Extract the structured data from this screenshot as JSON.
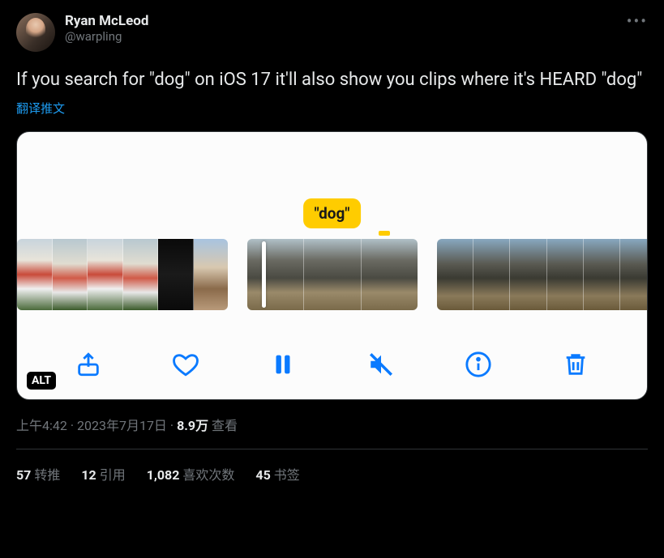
{
  "author": {
    "display_name": "Ryan McLeod",
    "handle": "@warpling"
  },
  "tweet_text": "If you search for \"dog\" on iOS 17 it'll also show you clips where it's HEARD \"dog\"",
  "translate_label": "翻译推文",
  "media": {
    "search_label": "\"dog\"",
    "alt_badge": "ALT"
  },
  "meta": {
    "time": "上午4:42",
    "date": "2023年7月17日",
    "views_count": "8.9万",
    "views_label": " 查看",
    "sep": " · "
  },
  "stats": {
    "retweets_count": "57",
    "retweets_label": "转推",
    "quotes_count": "12",
    "quotes_label": "引用",
    "likes_count": "1,082",
    "likes_label": "喜欢次数",
    "bookmarks_count": "45",
    "bookmarks_label": "书签"
  }
}
